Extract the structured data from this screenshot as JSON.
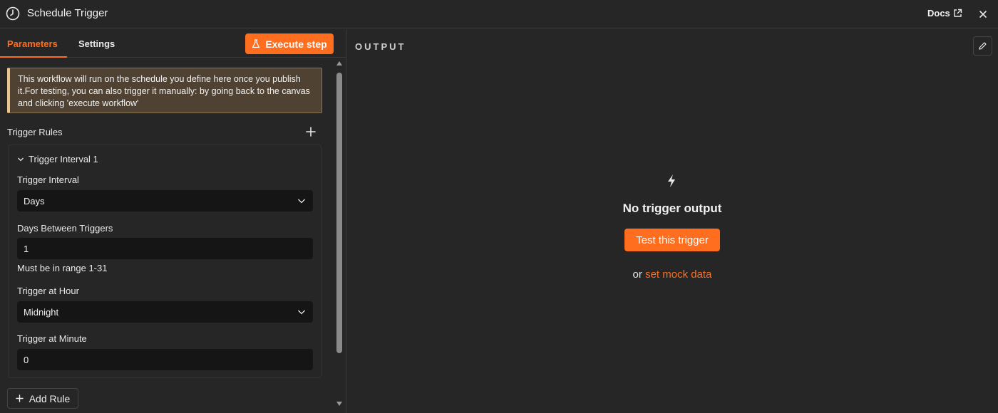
{
  "header": {
    "title": "Schedule Trigger",
    "docs_label": "Docs",
    "icons": {
      "title": "clock-icon",
      "docs": "external-link-icon",
      "close": "close-icon"
    }
  },
  "tabs": [
    {
      "label": "Parameters",
      "active": true
    },
    {
      "label": "Settings",
      "active": false
    }
  ],
  "execute_button": {
    "label": "Execute step",
    "icon": "flask-icon"
  },
  "notice": {
    "text": "This workflow will run on the schedule you define here once you publish it.For testing, you can also trigger it manually: by going back to the canvas and clicking 'execute workflow'"
  },
  "trigger_rules": {
    "label": "Trigger Rules",
    "rule_title": "Trigger Interval 1",
    "fields": {
      "interval": {
        "label": "Trigger Interval",
        "value": "Days"
      },
      "days_between": {
        "label": "Days Between Triggers",
        "value": "1",
        "hint": "Must be in range 1-31"
      },
      "hour": {
        "label": "Trigger at Hour",
        "value": "Midnight"
      },
      "minute": {
        "label": "Trigger at Minute",
        "value": "0"
      }
    },
    "add_rule_label": "Add Rule"
  },
  "output": {
    "label": "OUTPUT",
    "empty_title": "No trigger output",
    "test_button_label": "Test this trigger",
    "mock_prefix": "or",
    "mock_link_label": "set mock data"
  },
  "colors": {
    "accent": "#ff6d1f",
    "background": "#262626",
    "input_background": "#151515",
    "notice_background": "#4f4232",
    "notice_border": "#ecc58c"
  }
}
